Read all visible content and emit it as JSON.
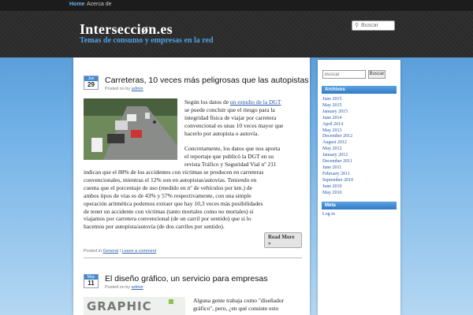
{
  "nav": {
    "home": "Home",
    "about": "Acerca de"
  },
  "site": {
    "title": "Intersecciøn.es",
    "description": "Temas de consumo y empresas en la red"
  },
  "header_search": {
    "placeholder": "Buscar"
  },
  "posts": [
    {
      "month": "Jun",
      "day": "29",
      "title": "Carreteras, 10 veces más peligrosas que las autopistas",
      "meta_prefix": "Posted on by",
      "author": "admin",
      "p1_lines": [
        "Según los datos de",
        "se puede concluir que el riesgo para la",
        "integridad física de viajar por carretera",
        "convencional es unas 10 veces mayor que",
        "hacerlo por autopista o autovía."
      ],
      "p1_link": "un estudio de la DGT",
      "p2_lines": [
        "Concretamente, los datos que nos aporta",
        "el reportaje que publicó la DGT en su",
        "revista Tráfico y Seguridad Vial nº 211",
        "indican que el 88% de los accidentes con víctimas se producen en carreteras",
        "convencionales, mientras el 12% son en autopistas/autovías. Teniendo en",
        "cuenta que el porcentaje de uso (medido en nº de vehículos por km.) de",
        "ambos tipos de vías es de 43% y 57% respectivamente, con una simple",
        "operación aritmética podemos extraer que hay 10,3 veces más posibilidades",
        "de tener un accidente con víctimas (tanto mortales como no mortales) si",
        "viajamos por carretera convencional (de un carril por sentido) que si lo",
        "hacemos por autopista/autovía (de dos carriles por sentido)."
      ],
      "read_more": "Read More »",
      "foot_prefix": "Posted in",
      "category": "General",
      "separator": "|",
      "comment_link": "Leave a comment"
    },
    {
      "month": "May",
      "day": "11",
      "title": "El diseño gráfico, un servicio para empresas",
      "meta_prefix": "Posted on by",
      "author": "admin",
      "lines": [
        "Alguna gente trabaja como \"diseñador",
        "gráfico\", pero, ¿en qué consiste esto"
      ],
      "thumb_text": "GRAPHIC"
    }
  ],
  "sidebar": {
    "search_placeholder": "Buscar",
    "search_button": "Buscar",
    "archives_title": "Archivos",
    "archives": [
      "June 2015",
      "May 2015",
      "January 2015",
      "June 2014",
      "April 2014",
      "May 2013",
      "December 2012",
      "August 2012",
      "May 2012",
      "January 2012",
      "December 2011",
      "June 2011",
      "February 2011",
      "September 2010",
      "June 2010",
      "May 2010"
    ],
    "meta_title": "Meta",
    "meta_items": [
      "Log in"
    ]
  },
  "colors": {
    "accent": "#3f8ad0",
    "header_bg": "#2a2a2a",
    "link": "#2255aa"
  }
}
